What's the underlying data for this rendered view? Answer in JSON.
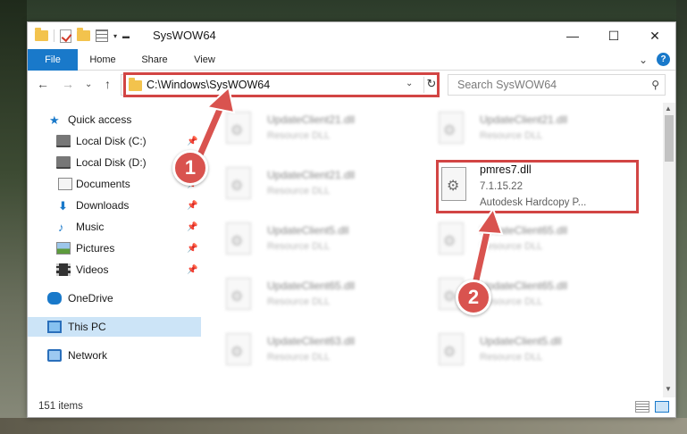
{
  "window": {
    "title": "SysWOW64",
    "controls": {
      "minimize": "—",
      "maximize": "☐",
      "close": "✕"
    }
  },
  "ribbon": {
    "tabs": {
      "file": "File",
      "home": "Home",
      "share": "Share",
      "view": "View"
    },
    "expand": "⌄",
    "help": "?"
  },
  "navigation": {
    "back": "←",
    "forward": "→",
    "recent": "⌄",
    "up": "↑",
    "address": "C:\\Windows\\SysWOW64",
    "search_placeholder": "Search SysWOW64"
  },
  "sidebar": {
    "items": [
      {
        "label": "Quick access",
        "icon": "star-icon",
        "pinned": false
      },
      {
        "label": "Local Disk (C:)",
        "icon": "drive-icon",
        "pinned": true
      },
      {
        "label": "Local Disk (D:)",
        "icon": "drive-icon",
        "pinned": false
      },
      {
        "label": "Documents",
        "icon": "document-icon",
        "pinned": true
      },
      {
        "label": "Downloads",
        "icon": "download-icon",
        "pinned": true
      },
      {
        "label": "Music",
        "icon": "music-icon",
        "pinned": true
      },
      {
        "label": "Pictures",
        "icon": "pictures-icon",
        "pinned": true
      },
      {
        "label": "Videos",
        "icon": "videos-icon",
        "pinned": true
      },
      {
        "label": "OneDrive",
        "icon": "cloud-icon",
        "pinned": false
      },
      {
        "label": "This PC",
        "icon": "computer-icon",
        "pinned": false,
        "selected": true
      },
      {
        "label": "Network",
        "icon": "network-icon",
        "pinned": false
      }
    ]
  },
  "files": {
    "background_tiles": [
      {
        "name": "UpdateClient21.dll",
        "type": "Resource DLL"
      },
      {
        "name": "UpdateClient21.dll",
        "type": "Resource DLL"
      },
      {
        "name": "UpdateClient21.dll",
        "type": "Resource DLL"
      },
      {
        "name": "UpdateClient5.dll",
        "type": "Resource DLL"
      },
      {
        "name": "UpdateClient65.dll",
        "type": "Resource DLL"
      },
      {
        "name": "UpdateClient65.dll",
        "type": "Resource DLL"
      },
      {
        "name": "UpdateClient65.dll",
        "type": "Resource DLL"
      },
      {
        "name": "UpdateClient63.dll",
        "type": "Resource DLL"
      },
      {
        "name": "UpdateClient5.dll",
        "type": "Resource DLL"
      }
    ],
    "highlighted": {
      "name": "pmres7.dll",
      "version": "7.1.15.22",
      "description": "Autodesk Hardcopy P..."
    }
  },
  "status": {
    "item_count": "151 items"
  },
  "annotations": {
    "step1": "1",
    "step2": "2"
  },
  "colors": {
    "accent": "#1979ca",
    "annotation_red": "#d24544"
  }
}
